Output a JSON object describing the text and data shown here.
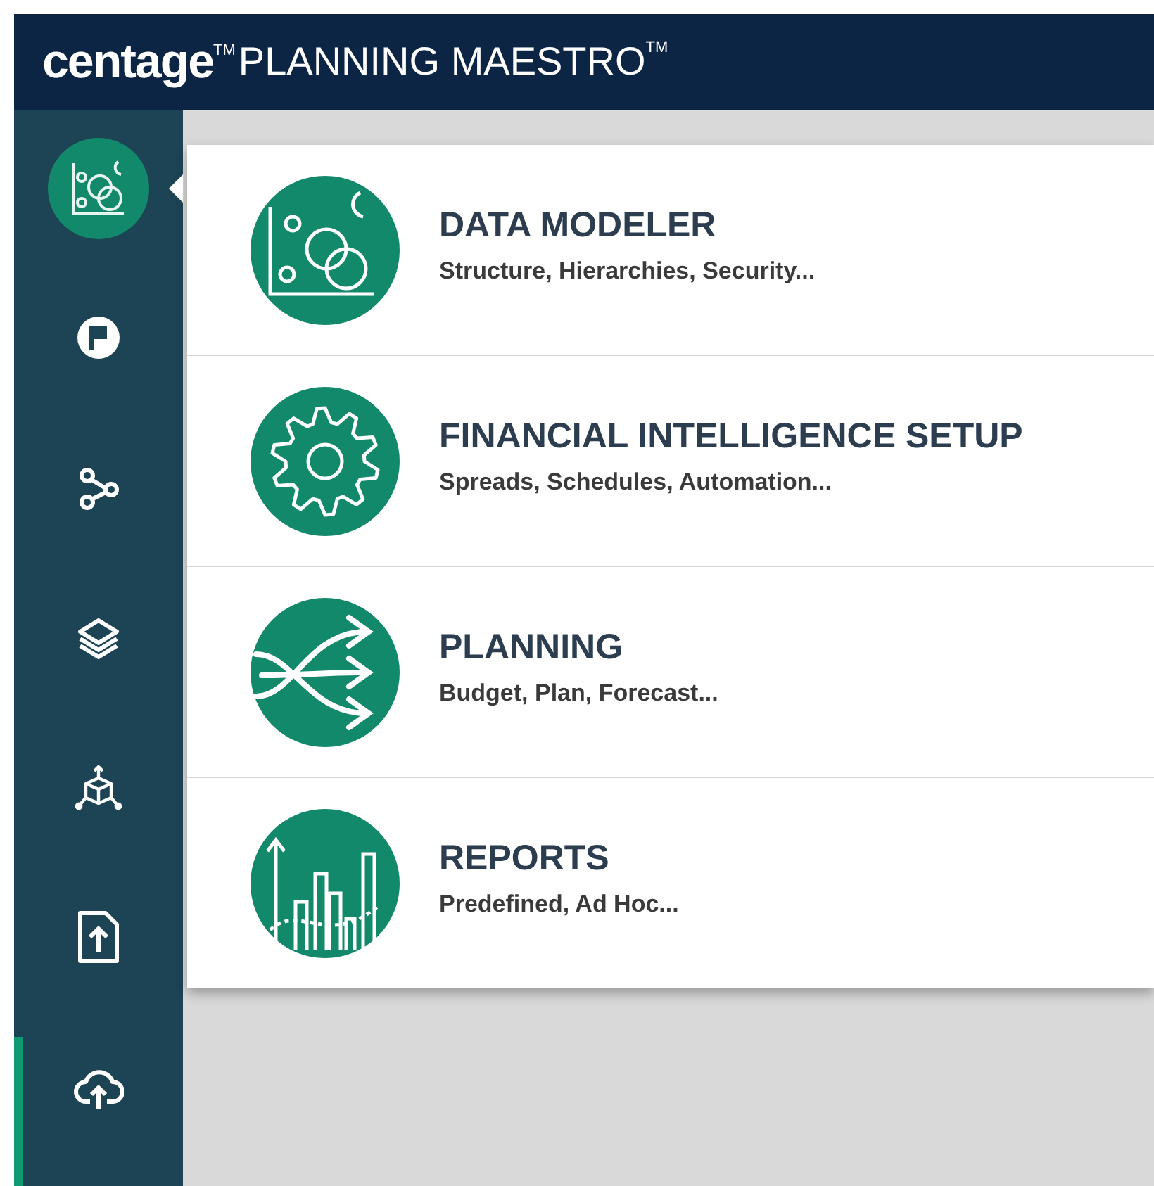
{
  "header": {
    "logo": "centage$^{TM}$",
    "product": "PLANNING MAESTRO$^{TM}$"
  },
  "sidebar": {
    "items": [
      {
        "selected": true,
        "current": false
      },
      {
        "selected": false,
        "current": false
      },
      {
        "selected": false,
        "current": false
      },
      {
        "selected": false,
        "current": false
      },
      {
        "selected": false,
        "current": false
      },
      {
        "selected": false,
        "current": false
      },
      {
        "selected": false,
        "current": true
      }
    ]
  },
  "modules": [
    {
      "title": "DATA MODELER",
      "subtitle": "Structure, Hierarchies, Security..."
    },
    {
      "title": "FINANCIAL INTELLIGENCE SETUP",
      "subtitle": "Spreads, Schedules, Automation..."
    },
    {
      "title": "PLANNING",
      "subtitle": "Budget, Plan, Forecast..."
    },
    {
      "title": "REPORTS",
      "subtitle": "Predefined, Ad Hoc..."
    }
  ]
}
